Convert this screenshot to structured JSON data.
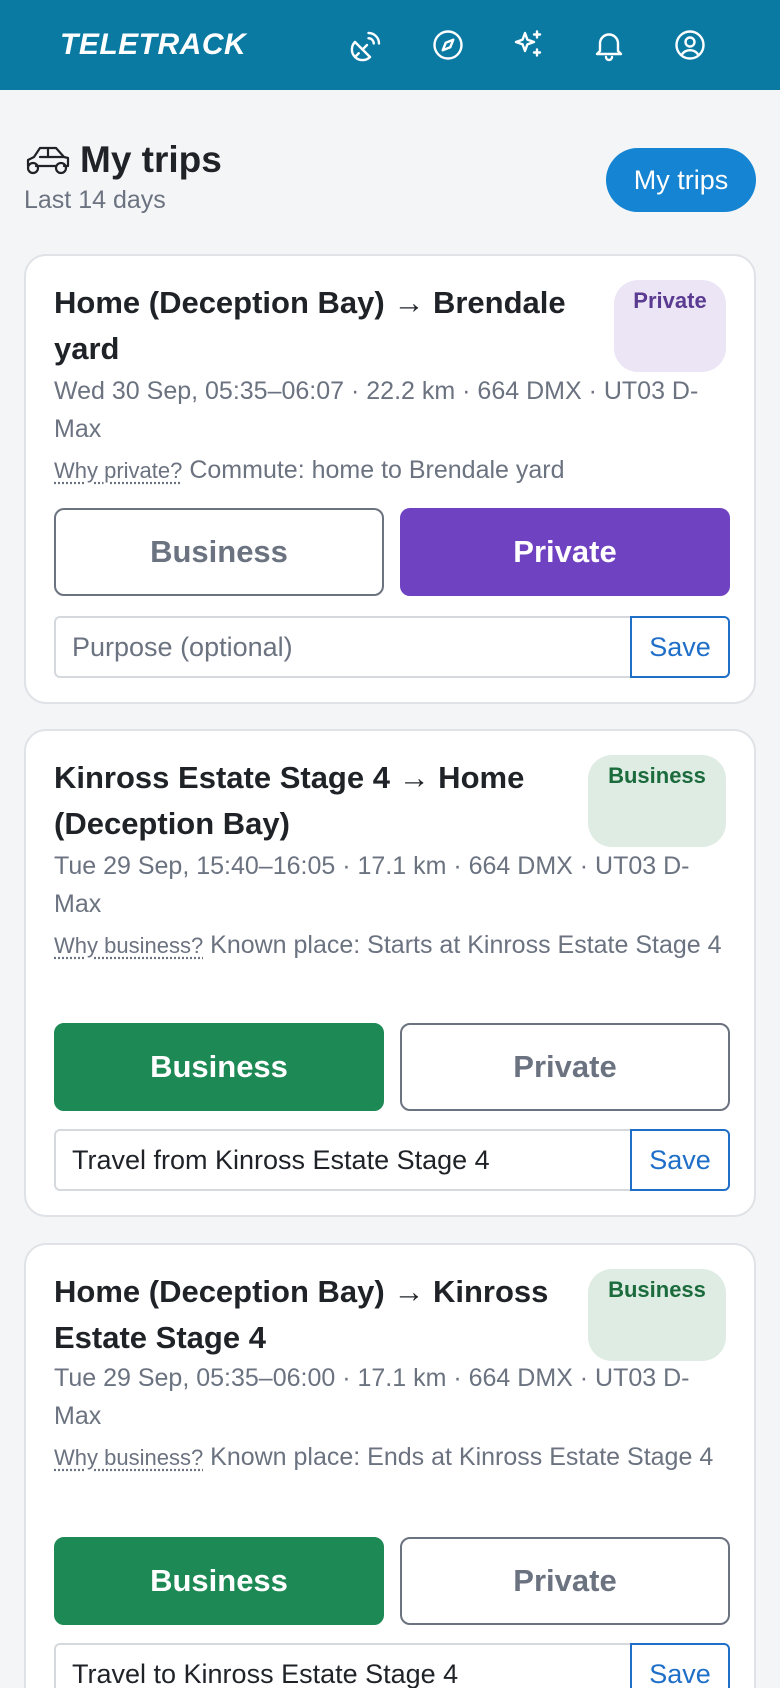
{
  "app": {
    "logo": "TELETRACK"
  },
  "nav": {
    "icons": [
      "satellite-dish-icon",
      "compass-icon",
      "sparkles-icon",
      "bell-icon",
      "user-circle-icon"
    ]
  },
  "header": {
    "title": "My trips",
    "subtitle": "Last 14 days",
    "button_label": "My trips"
  },
  "colors": {
    "topbar": "#0a7aa3",
    "primary": "#1584d2",
    "private": "#6f42c1",
    "business": "#1d8a55"
  },
  "trips": [
    {
      "route": "Home (Deception Bay) → Brendale yard",
      "badge": "Private",
      "meta": "Wed 30 Sep, 05:35–06:07 · 22.2 km · 664 DMX · UT03 D-Max",
      "why_label": "Why private?",
      "reason": "Commute: home to Brendale yard",
      "business_label": "Business",
      "private_label": "Private",
      "selected": "private",
      "purpose_value": "",
      "purpose_placeholder": "Purpose (optional)",
      "save_label": "Save"
    },
    {
      "route": "Kinross Estate Stage 4 → Home (Deception Bay)",
      "badge": "Business",
      "meta": "Tue 29 Sep, 15:40–16:05 · 17.1 km · 664 DMX · UT03 D-Max",
      "why_label": "Why business?",
      "reason": "Known place: Starts at Kinross Estate Stage 4",
      "business_label": "Business",
      "private_label": "Private",
      "selected": "business",
      "purpose_value": "Travel from Kinross Estate Stage 4",
      "purpose_placeholder": "Purpose (optional)",
      "save_label": "Save"
    },
    {
      "route": "Home (Deception Bay) → Kinross Estate Stage 4",
      "badge": "Business",
      "meta": "Tue 29 Sep, 05:35–06:00 · 17.1 km · 664 DMX · UT03 D-Max",
      "why_label": "Why business?",
      "reason": "Known place: Ends at Kinross Estate Stage 4",
      "business_label": "Business",
      "private_label": "Private",
      "selected": "business",
      "purpose_value": "Travel to Kinross Estate Stage 4",
      "purpose_placeholder": "Purpose (optional)",
      "save_label": "Save"
    }
  ]
}
